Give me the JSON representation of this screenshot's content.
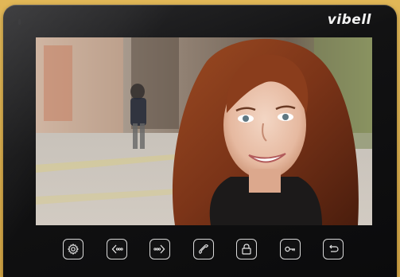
{
  "device": {
    "brand": "vibell",
    "body_color": "#111112",
    "frame_background": "#d8ad4d"
  },
  "screen": {
    "content": "camera-view"
  },
  "controls": [
    {
      "name": "settings-button",
      "icon": "gear-icon"
    },
    {
      "name": "previous-button",
      "icon": "chevron-left-dots-icon"
    },
    {
      "name": "next-button",
      "icon": "chevron-right-dots-icon"
    },
    {
      "name": "call-button",
      "icon": "phone-handset-icon"
    },
    {
      "name": "lock-button",
      "icon": "lock-icon"
    },
    {
      "name": "key-button",
      "icon": "key-icon"
    },
    {
      "name": "back-button",
      "icon": "return-arrow-icon"
    }
  ]
}
